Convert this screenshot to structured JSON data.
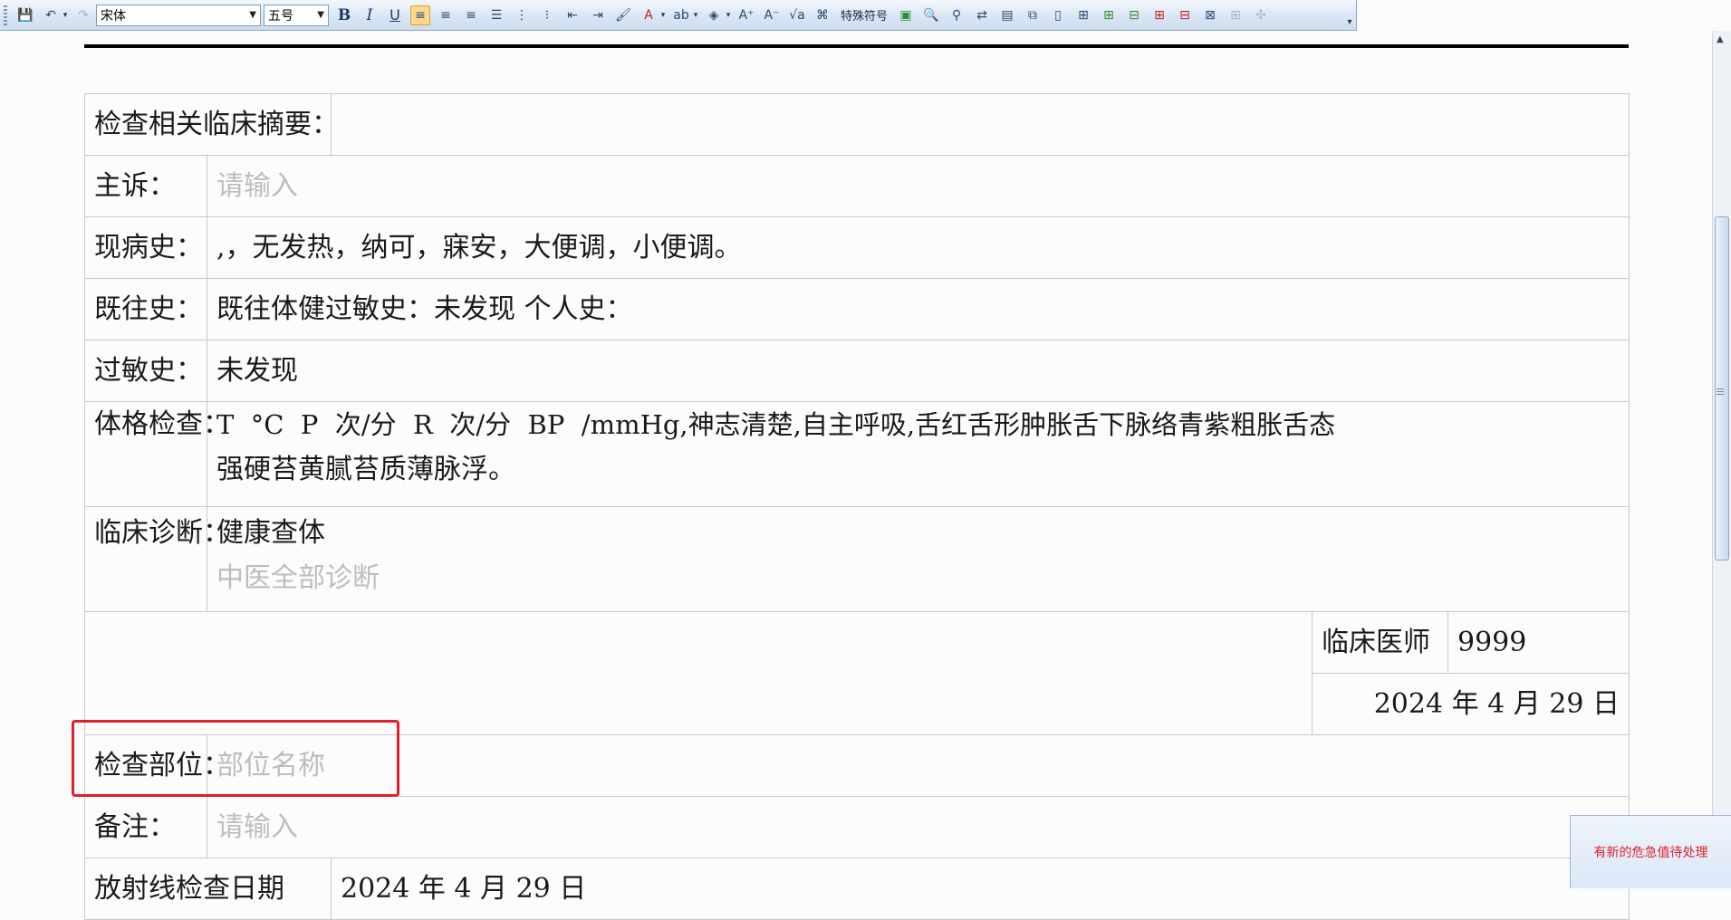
{
  "toolbar": {
    "font_name": "宋体",
    "font_size": "五号",
    "special_symbol_label": "特殊符号",
    "colors": {
      "accent": "#2b4a75",
      "active_bg": "#ffd990",
      "toolbar_bg": "#d9e6f5"
    }
  },
  "document": {
    "section_heading": "检查相关临床摘要：",
    "chief_complaint": {
      "label": "主诉：",
      "placeholder": "请输入"
    },
    "present_illness": {
      "label": "现病史：",
      "value": ",，无发热，纳可，寐安，大便调，小便调。"
    },
    "past_history": {
      "label": "既往史：",
      "value": "既往体健过敏史：未发现 个人史："
    },
    "allergy_history": {
      "label": "过敏史：",
      "value": "未发现"
    },
    "physical_exam": {
      "label": "体格检查：",
      "line1": "T  °C  P  次/分  R  次/分  BP  /mmHg,神志清楚,自主呼吸,舌红舌形肿胀舌下脉络青紫粗胀舌态",
      "line2": "强硬苔黄腻苔质薄脉浮。"
    },
    "clinical_diagnosis": {
      "label": "临床诊断：",
      "value": "健康查体",
      "placeholder": "中医全部诊断"
    },
    "clinician": {
      "label": "临床医师",
      "value": "9999",
      "date": "2024 年 4 月 29 日"
    },
    "exam_site": {
      "label": "检查部位：",
      "placeholder": "部位名称"
    },
    "remarks": {
      "label": "备注：",
      "placeholder": "请输入"
    },
    "radiation_date": {
      "label": "放射线检查日期",
      "value": "2024 年 4 月 29 日"
    },
    "highlight_color": "#e0202a"
  },
  "notification": {
    "text": "有新的危急值待处理"
  }
}
